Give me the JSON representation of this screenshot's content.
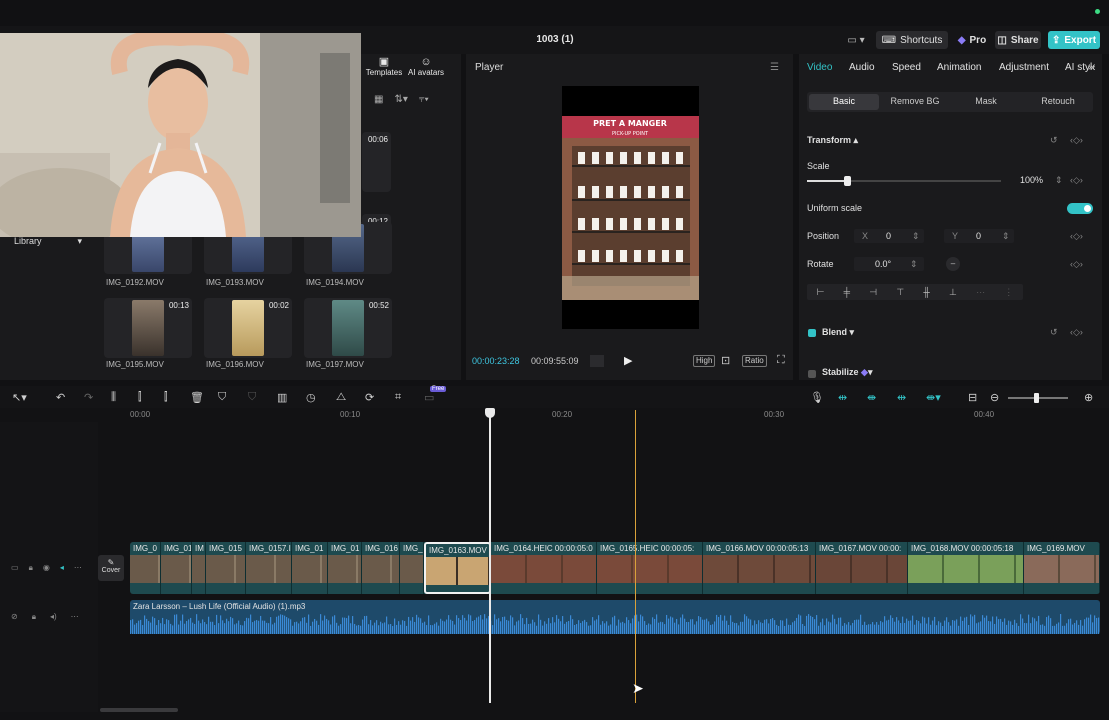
{
  "header": {
    "title": "1003 (1)",
    "shortcuts": "Shortcuts",
    "pro": "Pro",
    "share": "Share",
    "export": "Export"
  },
  "media": {
    "tabs": [
      {
        "label": "Templates"
      },
      {
        "label": "AI avatars"
      }
    ],
    "library_label": "Library",
    "items": [
      {
        "name": "IMG_0192.MOV",
        "duration": ""
      },
      {
        "name": "IMG_0193.MOV",
        "duration": ""
      },
      {
        "name": "IMG_0194.MOV",
        "duration": ""
      },
      {
        "name": "IMG_0195.MOV",
        "duration": "00:13"
      },
      {
        "name": "IMG_0196.MOV",
        "duration": "00:02"
      },
      {
        "name": "IMG_0197.MOV",
        "duration": "00:52"
      }
    ],
    "partial_durations": [
      "00:06",
      "00:12"
    ]
  },
  "player": {
    "title": "Player",
    "current_time": "00:00:23:28",
    "total_time": "00:09:55:09",
    "quality_label": "High",
    "ratio_label": "Ratio",
    "sign_text": "PRET A MANGER",
    "sign_sub": "PICK-UP POINT"
  },
  "properties": {
    "tabs": [
      "Video",
      "Audio",
      "Speed",
      "Animation",
      "Adjustment",
      "AI style"
    ],
    "subtabs": [
      "Basic",
      "Remove BG",
      "Mask",
      "Retouch"
    ],
    "transform_label": "Transform",
    "scale_label": "Scale",
    "scale_value": "100%",
    "scale_fraction": 0.21,
    "uniform_scale_label": "Uniform scale",
    "uniform_scale_on": true,
    "position_label": "Position",
    "x_label": "X",
    "x_value": "0",
    "y_label": "Y",
    "y_value": "0",
    "rotate_label": "Rotate",
    "rotate_value": "0.0°",
    "blend_label": "Blend",
    "stabilize_label": "Stabilize"
  },
  "timeline": {
    "ruler": [
      "00:00",
      "00:10",
      "00:20",
      "00:30",
      "00:40"
    ],
    "cover_label": "Cover",
    "clips": [
      {
        "label": "IMG_0"
      },
      {
        "label": "IMG_01"
      },
      {
        "label": "IM"
      },
      {
        "label": "IMG_015"
      },
      {
        "label": "IMG_0157.I"
      },
      {
        "label": "IMG_01"
      },
      {
        "label": "IMG_01"
      },
      {
        "label": "IMG_016"
      },
      {
        "label": "IMG_"
      },
      {
        "label": "IMG_0163.MOV"
      },
      {
        "label": "IMG_0164.HEIC  00:00:05:0"
      },
      {
        "label": "IMG_0165.HEIC  00:00:05:"
      },
      {
        "label": "IMG_0166.MOV  00:00:05:13"
      },
      {
        "label": "IMG_0167.MOV  00:00:"
      },
      {
        "label": "IMG_0168.MOV  00:00:05:18"
      },
      {
        "label": "IMG_0169.MOV"
      }
    ],
    "audio_label": "Zara Larsson – Lush Life (Official Audio) (1).mp3",
    "badge": "Free"
  },
  "colors": {
    "accent": "#33c3c7",
    "time": "#3ec6e0",
    "video_track": "#1e4a4f",
    "audio_track": "#1e4a6a",
    "hover_line": "#d9a13a"
  }
}
